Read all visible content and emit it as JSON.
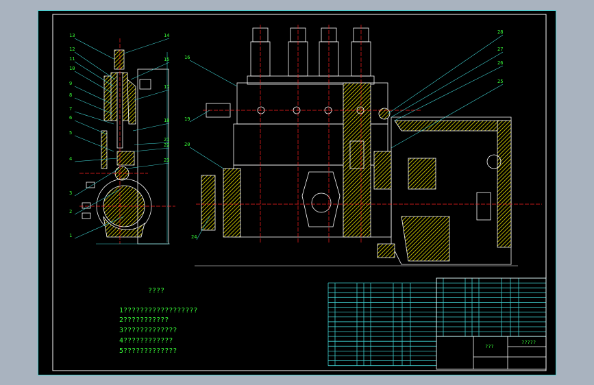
{
  "drawing": {
    "part_labels_section": [
      "13",
      "12",
      "11",
      "10",
      "9",
      "8",
      "7",
      "6",
      "5",
      "4",
      "3",
      "2",
      "1",
      "14",
      "15",
      "17",
      "18",
      "21",
      "22",
      "23"
    ],
    "part_labels_main": [
      "16",
      "19",
      "20",
      "24",
      "28",
      "27",
      "26",
      "25"
    ],
    "notes": {
      "title": "????",
      "items": [
        "1??????????????????",
        "2???????????",
        "3?????????????",
        "4????????????",
        "5?????????????"
      ]
    },
    "title_block": {
      "drawing_title": "???",
      "company": "?????"
    }
  },
  "colors": {
    "background": "#000000",
    "frame": "#ffffff",
    "border": "#3fd0d0",
    "text": "#39ff39",
    "section_hatch": "#e8e000",
    "centerline": "#ff2020"
  }
}
